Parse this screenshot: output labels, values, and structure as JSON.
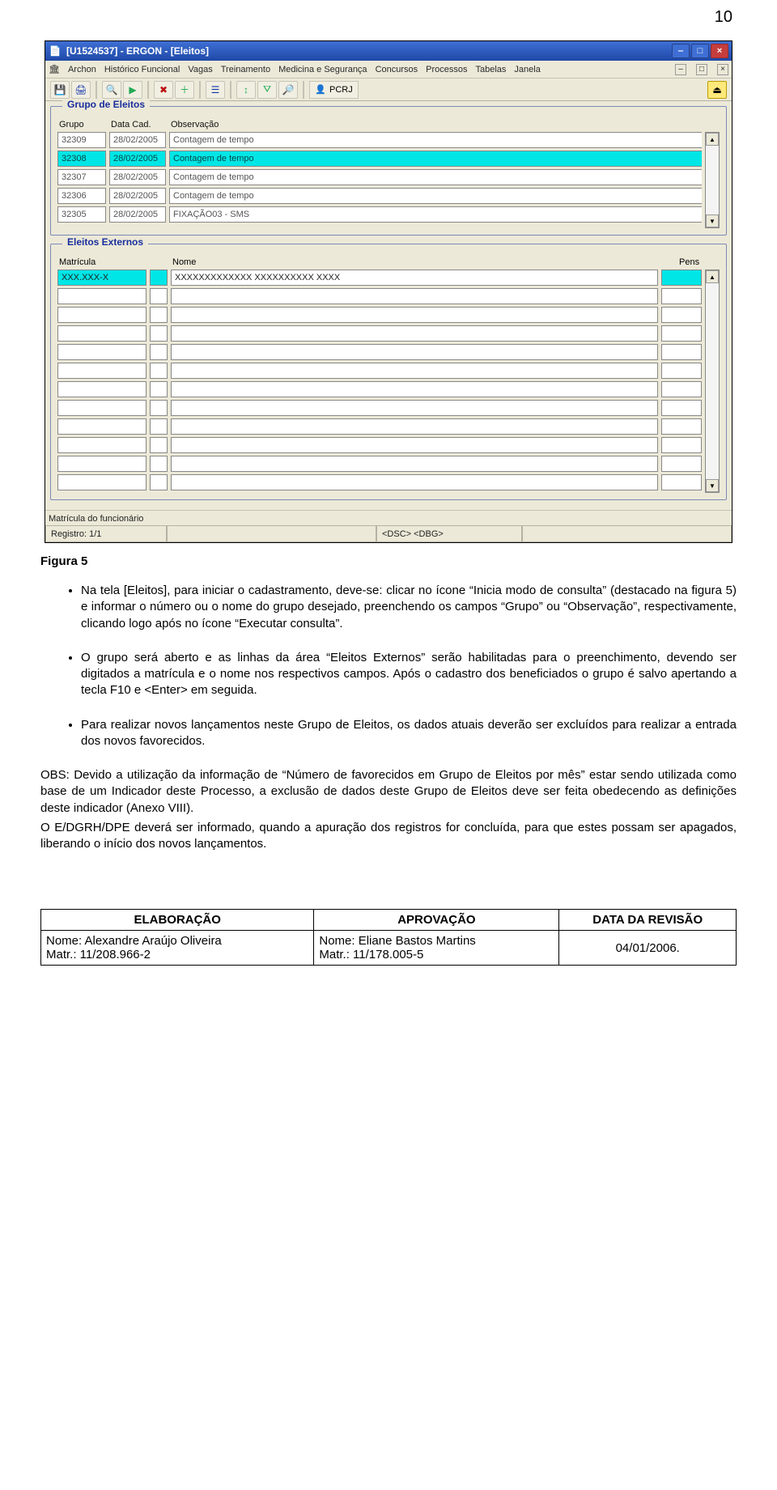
{
  "page_number": "10",
  "window": {
    "title": "[U1524537] - ERGON - [Eleitos]",
    "menu": [
      "Archon",
      "Histórico Funcional",
      "Vagas",
      "Treinamento",
      "Medicina e Segurança",
      "Concursos",
      "Processos",
      "Tabelas",
      "Janela"
    ],
    "toolbar_label": "PCRJ",
    "status_hint": "Matrícula do funcionário",
    "status_record": "Registro: 1/1",
    "status_modes": "<DSC> <DBG>"
  },
  "grupo_eleitos": {
    "legend": "Grupo de Eleitos",
    "headers": {
      "grupo": "Grupo",
      "data": "Data Cad.",
      "obs": "Observação"
    },
    "rows": [
      {
        "grupo": "32309",
        "data": "28/02/2005",
        "obs": "Contagem de tempo",
        "sel": false
      },
      {
        "grupo": "32308",
        "data": "28/02/2005",
        "obs": "Contagem de tempo",
        "sel": true
      },
      {
        "grupo": "32307",
        "data": "28/02/2005",
        "obs": "Contagem de tempo",
        "sel": false
      },
      {
        "grupo": "32306",
        "data": "28/02/2005",
        "obs": "Contagem de tempo",
        "sel": false
      },
      {
        "grupo": "32305",
        "data": "28/02/2005",
        "obs": "FIXAÇÃO03 - SMS",
        "sel": false
      }
    ]
  },
  "eleitos_externos": {
    "legend": "Eleitos Externos",
    "headers": {
      "matricula": "Matrícula",
      "nome": "Nome",
      "pens": "Pens"
    },
    "first_row": {
      "matricula": "XXX.XXX-X",
      "nome": "XXXXXXXXXXXXX XXXXXXXXXX XXXX"
    },
    "blank_rows": 11
  },
  "figure_label": "Figura 5",
  "bullets": [
    "Na tela [Eleitos], para iniciar o cadastramento, deve-se: clicar no ícone “Inicia modo de consulta” (destacado na figura 5) e informar o número ou o nome do grupo desejado, preenchendo os campos “Grupo” ou “Observação”, respectivamente, clicando logo após no ícone “Executar consulta”.",
    "O grupo será aberto e as linhas da área “Eleitos Externos” serão habilitadas para o preenchimento, devendo ser digitados a matrícula e o nome nos respectivos campos. Após o cadastro dos beneficiados o grupo é salvo apertando a tecla F10 e <Enter> em seguida.",
    "Para realizar novos lançamentos neste Grupo de Eleitos, os dados atuais deverão ser excluídos para realizar a entrada dos novos favorecidos."
  ],
  "obs": {
    "p1": "OBS: Devido a utilização da informação de “Número de favorecidos em Grupo de Eleitos por mês” estar sendo utilizada como base de um Indicador deste Processo, a exclusão de dados deste Grupo de Eleitos deve ser feita obedecendo as definições deste indicador (Anexo VIII).",
    "p2": "O E/DGRH/DPE deverá ser informado, quando a apuração dos registros for concluída, para que estes possam ser apagados, liberando o início dos novos lançamentos."
  },
  "footer": {
    "h1": "ELABORAÇÃO",
    "h2": "APROVAÇÃO",
    "h3": "DATA DA REVISÃO",
    "elab_nome": "Nome: Alexandre Araújo Oliveira",
    "elab_matr": "Matr.: 11/208.966-2",
    "aprov_nome": "Nome: Eliane Bastos Martins",
    "aprov_matr": "Matr.: 11/178.005-5",
    "data": "04/01/2006."
  }
}
